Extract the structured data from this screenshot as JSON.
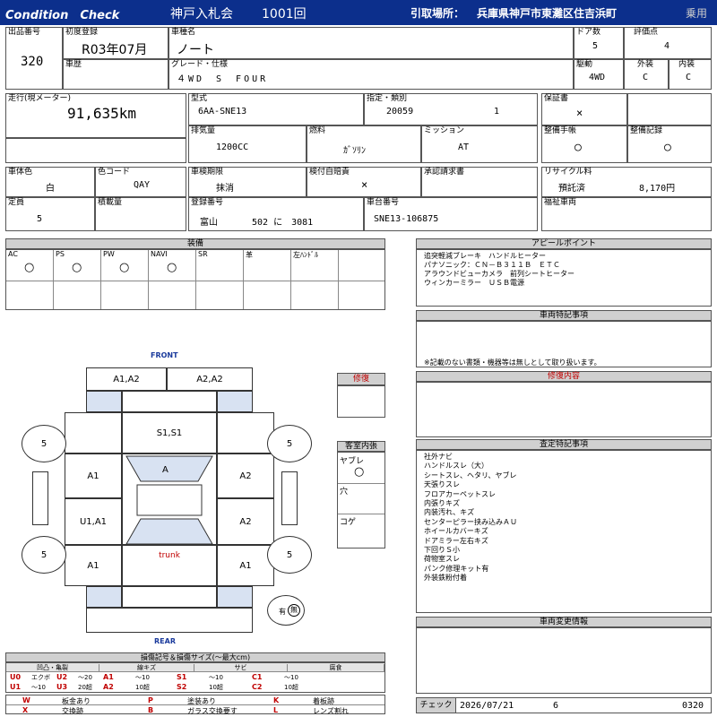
{
  "header": {
    "title_left": "Condition　Check",
    "auction": "神戸入札会",
    "lot_no": "1001回",
    "pickup_label": "引取場所：",
    "pickup_place": "兵庫県神戸市東灘区住吉浜町",
    "category": "乗用"
  },
  "row1": {
    "lot_label": "出品番号",
    "lot_value": "320",
    "first_reg_label": "初度登録",
    "first_reg_value": "R03年07月",
    "car_name_label": "車種名",
    "car_name_value": "ノート",
    "doors_label": "ドア数",
    "doors_value": "5",
    "score_label": "評価点",
    "score_value": "4",
    "history_label": "車歴",
    "grade_label": "グレード・仕様",
    "grade_value": "４WD　S　FOUR",
    "drive_label": "駆動",
    "drive_value": "4WD",
    "ext_label": "外装",
    "ext_value": "C",
    "int_label": "内装",
    "int_value": "C"
  },
  "row2": {
    "mileage_label": "走行(現メーター)",
    "mileage_value": "91,635km",
    "model_label": "型式",
    "model_value": "6AA-SNE13",
    "designation_label": "指定・類別",
    "designation_value": "20059",
    "class_value": "1",
    "warranty_label": "保証書",
    "warranty_value": "×",
    "displacement_label": "排気量",
    "displacement_value": "1200CC",
    "fuel_label": "燃料",
    "fuel_value": "ｶﾞｿﾘﾝ",
    "mission_label": "ミッション",
    "mission_value": "AT",
    "manual_label": "整備手帳",
    "manual_value": "○",
    "record_label": "整備記録",
    "record_value": "○"
  },
  "row3": {
    "body_color_label": "車体色",
    "body_color_value": "白",
    "color_code_label": "色コード",
    "color_code_value": "QAY",
    "inspection_label": "車検期限",
    "inspection_value": "抹消",
    "insurance_label": "検付自賠責",
    "insurance_value": "×",
    "approval_label": "承認請求書",
    "recycle_label": "リサイクル料",
    "recycle_status": "預託済",
    "recycle_value": "8,170円",
    "capacity_label": "定員",
    "capacity_value": "5",
    "load_label": "積載量",
    "regno_label": "登録番号",
    "regno_place": "富山",
    "regno_num": "502 に　3081",
    "chassis_label": "車台番号",
    "chassis_value": "SNE13-106875",
    "welfare_label": "福祉車両"
  },
  "equipment": {
    "title": "装備",
    "items": [
      {
        "label": "AC",
        "value": "○"
      },
      {
        "label": "PS",
        "value": "○"
      },
      {
        "label": "PW",
        "value": "○"
      },
      {
        "label": "NAVI",
        "value": "○"
      },
      {
        "label": "SR",
        "value": ""
      },
      {
        "label": "革",
        "value": ""
      },
      {
        "label": "左ﾊﾝﾄﾞﾙ",
        "value": ""
      }
    ]
  },
  "appeal": {
    "title": "アピールポイント",
    "lines": [
      "追突軽減ブレーキ　ハンドルヒーター",
      "パナソニック：ＣＮ－Ｂ３１１Ｂ　ＥＴＣ",
      "アラウンドビューカメラ　前列シートヒーター",
      "ウィンカーミラー　ＵＳＢ電源"
    ]
  },
  "special": {
    "title": "車両特記事項",
    "note": "※記載のない書類・機器等は無しとして取り扱います。"
  },
  "repair_content": {
    "title": "修復内容"
  },
  "inspector_notes": {
    "title": "査定特記事項",
    "lines": [
      "社外ナビ",
      "ハンドルスレ（大）",
      "シートスレ、ヘタリ、ヤブレ",
      "天張りスレ",
      "フロアカーペットスレ",
      "内張りキズ",
      "内装汚れ、キズ",
      "センターピラー挟み込みＡＵ",
      "ホイールカバーキズ",
      "ドアミラー左右キズ",
      "下回りＳ小",
      "荷物室スレ",
      "パンク修理キット有",
      "外装鉄粉付着"
    ]
  },
  "change_info": {
    "title": "車両変更情報"
  },
  "diagram": {
    "front": "FRONT",
    "rear": "REAR",
    "trunk": "trunk",
    "cells": {
      "front_left": "A1,A2",
      "front_right": "A2,A2",
      "roof": "S1,S1",
      "left_front_door": "A1",
      "windshield": "A",
      "right_front_door": "A2",
      "left_rear_door": "U1,A1",
      "right_rear_door": "A2",
      "left_rear": "A1",
      "right_rear": "A1"
    },
    "tires": [
      "5",
      "5",
      "5",
      "5"
    ],
    "spare_label": "有",
    "spare_mark": "無"
  },
  "repair_box": {
    "title": "修復"
  },
  "cabin": {
    "title": "客室内張",
    "tear_label": "ヤブレ",
    "tear_value": "○",
    "hole_label": "穴",
    "burn_label": "コゲ"
  },
  "legend": {
    "title": "損傷記号＆損傷サイズ(〜最大cm)",
    "groups": [
      "凹凸・亀裂",
      "線キズ",
      "サビ",
      "腐食"
    ],
    "row1": [
      [
        "U0",
        "エクボ"
      ],
      [
        "U2",
        "〜20"
      ],
      [
        "A1",
        "〜10"
      ],
      [
        "S1",
        "〜10"
      ],
      [
        "C1",
        "〜10"
      ]
    ],
    "row2": [
      [
        "U1",
        "〜10"
      ],
      [
        "U3",
        "20超"
      ],
      [
        "A2",
        "10超"
      ],
      [
        "S2",
        "10超"
      ],
      [
        "C2",
        "10超"
      ]
    ],
    "row3": [
      [
        "W",
        "板金あり"
      ],
      [
        "P",
        "塗装あり"
      ],
      [
        "K",
        "着板跡"
      ]
    ],
    "row4": [
      [
        "X",
        "交換跡"
      ],
      [
        "B",
        "ガラス交換要す"
      ],
      [
        "L",
        "レンズ割れ"
      ]
    ]
  },
  "footer": {
    "check_label": "チェック",
    "date": "2026/07/21",
    "num": "6",
    "code": "0320"
  }
}
